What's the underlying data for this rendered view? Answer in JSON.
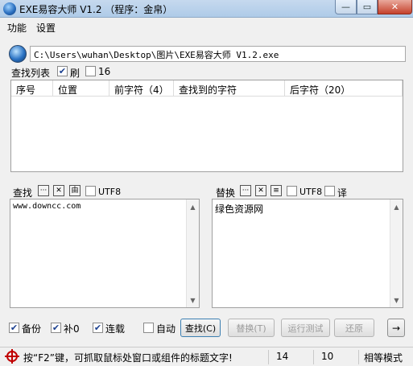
{
  "window": {
    "title": "EXE易容大师 V1.2 （程序：金帛）",
    "minimize_glyph": "—",
    "maximize_glyph": "▭",
    "close_glyph": "✕"
  },
  "menu": {
    "items": [
      {
        "label": "功能"
      },
      {
        "label": "设置"
      }
    ]
  },
  "path": {
    "value": "C:\\Users\\wuhan\\Desktop\\图片\\EXE易容大师 V1.2.exe"
  },
  "search_list": {
    "label": "查找列表",
    "refresh": {
      "label": "刷",
      "checked": true
    },
    "hex16": {
      "label": "16",
      "checked": false
    },
    "columns": [
      "序号",
      "位置",
      "前字符（4）",
      "查找到的字符",
      "后字符（20）"
    ]
  },
  "find_panel": {
    "label": "查找",
    "more_glyph": "···",
    "clear_glyph": "✕",
    "from_glyph": "由",
    "utf8": {
      "label": "UTF8",
      "checked": false
    },
    "text": "www.downcc.com"
  },
  "replace_panel": {
    "label": "替换",
    "more_glyph": "···",
    "clear_glyph": "✕",
    "equal_glyph": "≡",
    "utf8": {
      "label": "UTF8",
      "checked": false
    },
    "translate": {
      "label": "译",
      "checked": false
    },
    "text": "绿色资源网"
  },
  "options": {
    "backup": {
      "label": "备份",
      "checked": true
    },
    "pad0": {
      "label": "补0",
      "checked": true
    },
    "continuous": {
      "label": "连载",
      "checked": true
    },
    "auto": {
      "label": "自动",
      "checked": false
    }
  },
  "buttons": {
    "find": "查找(C)",
    "replace": "替换(T)",
    "run_test": "运行测试",
    "restore": "还原",
    "arrow": "→"
  },
  "status": {
    "tip": "按“F2”键，可抓取鼠标处窗口或组件的标题文字!",
    "left_count": "14",
    "right_count": "10",
    "mode": "相等模式"
  },
  "colors": {
    "titlebar": "#aecbe8",
    "close_button": "#c5412b",
    "crosshair": "#c00000"
  }
}
